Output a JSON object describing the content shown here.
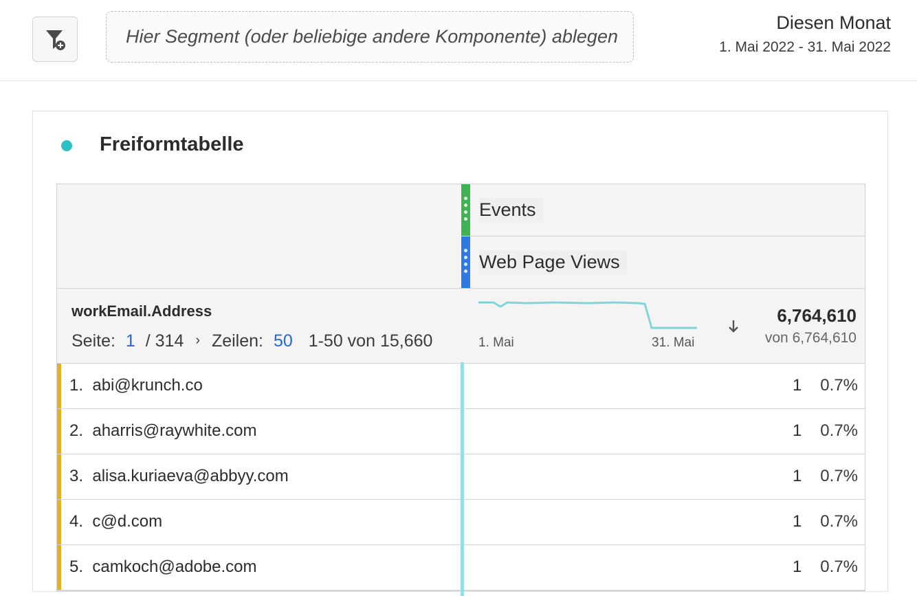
{
  "toolbar": {
    "drop_zone_placeholder": "Hier Segment (oder beliebige andere Komponente) ablegen",
    "date_label": "Diesen Monat",
    "date_range": "1. Mai 2022 - 31. Mai 2022",
    "segment_icon": "filter-add-icon"
  },
  "panel": {
    "title": "Freiformtabelle",
    "dot_color": "#2cc0c4"
  },
  "table": {
    "metrics": [
      {
        "label": "Events",
        "color": "#3fb34f"
      },
      {
        "label": "Web Page Views",
        "color": "#2d79e6"
      }
    ],
    "dimension": {
      "name": "workEmail.Address",
      "page_label": "Seite:",
      "page_current": "1",
      "page_total": "/ 314",
      "rows_label": "Zeilen:",
      "rows_count": "50",
      "range_text": "1-50 von 15,660"
    },
    "sparkline": {
      "start_label": "1. Mai",
      "end_label": "31. Mai",
      "color": "#7fd6da"
    },
    "total": "6,764,610",
    "total_of": "von 6,764,610",
    "sort_icon": "arrow-down-icon",
    "rows": [
      {
        "index": "1.",
        "label": "abi@krunch.co",
        "value": "1",
        "pct": "0.7%"
      },
      {
        "index": "2.",
        "label": "aharris@raywhite.com",
        "value": "1",
        "pct": "0.7%"
      },
      {
        "index": "3.",
        "label": "alisa.kuriaeva@abbyy.com",
        "value": "1",
        "pct": "0.7%"
      },
      {
        "index": "4.",
        "label": "c@d.com",
        "value": "1",
        "pct": "0.7%"
      },
      {
        "index": "5.",
        "label": "camkoch@adobe.com",
        "value": "1",
        "pct": "0.7%"
      }
    ],
    "row_marker_color": "#e6b223"
  }
}
